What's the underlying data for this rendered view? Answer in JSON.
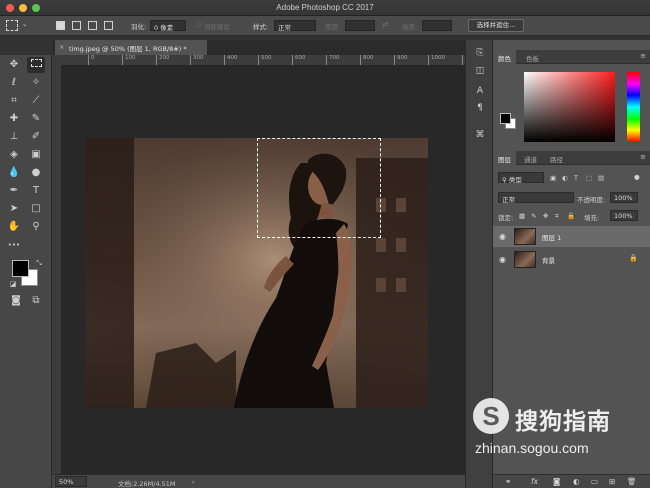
{
  "window": {
    "title": "Adobe Photoshop CC 2017"
  },
  "options_bar": {
    "feather_label": "羽化:",
    "feather_value": "0 像素",
    "antialias_label": "消除锯齿",
    "style_label": "样式:",
    "style_value": "正常",
    "width_label": "宽度:",
    "height_label": "高度:",
    "select_mask_button": "选择并遮住..."
  },
  "document": {
    "tab_title": "timg.jpeg @ 50% (图层 1, RGB/8#) *",
    "close_glyph": "×",
    "ruler_labels": [
      "0",
      "100",
      "200",
      "300",
      "400",
      "500",
      "600",
      "700",
      "800",
      "900",
      "1000",
      "1100"
    ]
  },
  "status_bar": {
    "zoom": "50%",
    "doc_size": "文档:2.26M/4.51M",
    "arrow": "›"
  },
  "toolbar": {
    "more_glyph": "•••"
  },
  "color_panel": {
    "tabs": [
      "颜色",
      "色板"
    ],
    "foreground": "#000000",
    "background": "#ffffff"
  },
  "layers_panel": {
    "tabs": [
      "图层",
      "通道",
      "路径"
    ],
    "filter_label": "类型",
    "blend_mode": "正常",
    "opacity_label": "不透明度:",
    "opacity_value": "100%",
    "lock_label": "锁定:",
    "fill_label": "填充:",
    "fill_value": "100%",
    "layers": [
      {
        "name": "图层 1",
        "selected": true,
        "locked": false
      },
      {
        "name": "背景",
        "selected": false,
        "locked": true
      }
    ],
    "footer_icons": [
      "link-icon",
      "fx-icon",
      "mask-icon",
      "adjustment-icon",
      "folder-icon",
      "new-layer-icon",
      "trash-icon"
    ],
    "fx_text": "fx"
  },
  "watermark": {
    "logo_letter": "S",
    "brand": "搜狗指南",
    "url": "zhinan.sogou.com"
  },
  "colors": {
    "app_bg": "#323232",
    "panel_bg": "#535353",
    "close": "#ed5e55",
    "minimize": "#f5be3f",
    "zoom": "#5fc44b"
  }
}
